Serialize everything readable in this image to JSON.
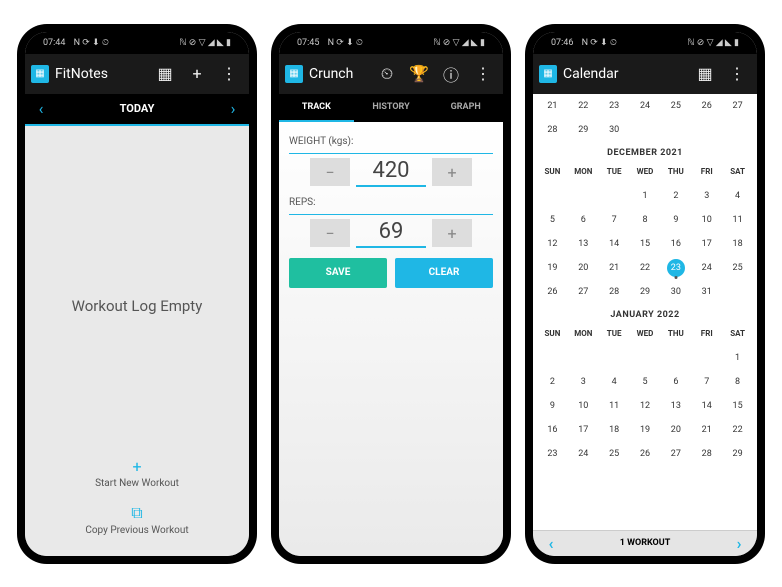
{
  "status": {
    "time_left": [
      "07:44",
      "07:45",
      "07:46"
    ],
    "left_icons": "N ⟳ ⬇ ⏲",
    "right_icons": "ℕ ⊘ ▽ ◢ ◣ ▮"
  },
  "screen1": {
    "app_title": "FitNotes",
    "date_label": "TODAY",
    "empty_message": "Workout Log Empty",
    "action_new": "Start New Workout",
    "action_copy": "Copy Previous Workout"
  },
  "screen2": {
    "app_title": "Crunch",
    "tabs": {
      "track": "TRACK",
      "history": "HISTORY",
      "graph": "GRAPH"
    },
    "weight_label": "WEIGHT (kgs):",
    "weight_value": "420",
    "reps_label": "REPS:",
    "reps_value": "69",
    "save_label": "SAVE",
    "clear_label": "CLEAR"
  },
  "screen3": {
    "app_title": "Calendar",
    "dow": [
      "SUN",
      "MON",
      "TUE",
      "WED",
      "THU",
      "FRI",
      "SAT"
    ],
    "prev_month_row1": [
      "",
      "21",
      "22",
      "23",
      "24",
      "25",
      "26",
      "27"
    ],
    "prev_month_row2": [
      "28",
      "29",
      "30",
      "",
      "",
      "",
      ""
    ],
    "month1_title": "DECEMBER 2021",
    "month1_rows": [
      [
        "",
        "",
        "",
        "1",
        "2",
        "3",
        "4"
      ],
      [
        "5",
        "6",
        "7",
        "8",
        "9",
        "10",
        "11"
      ],
      [
        "12",
        "13",
        "14",
        "15",
        "16",
        "17",
        "18"
      ],
      [
        "19",
        "20",
        "21",
        "22",
        "23",
        "24",
        "25"
      ],
      [
        "26",
        "27",
        "28",
        "29",
        "30",
        "31",
        ""
      ]
    ],
    "today_day": "23",
    "month2_title": "JANUARY 2022",
    "month2_rows": [
      [
        "",
        "",
        "",
        "",
        "",
        "",
        "1"
      ],
      [
        "2",
        "3",
        "4",
        "5",
        "6",
        "7",
        "8"
      ],
      [
        "9",
        "10",
        "11",
        "12",
        "13",
        "14",
        "15"
      ],
      [
        "16",
        "17",
        "18",
        "19",
        "20",
        "21",
        "22"
      ],
      [
        "23",
        "24",
        "25",
        "26",
        "27",
        "28",
        "29"
      ]
    ],
    "footer_label": "1 WORKOUT"
  }
}
